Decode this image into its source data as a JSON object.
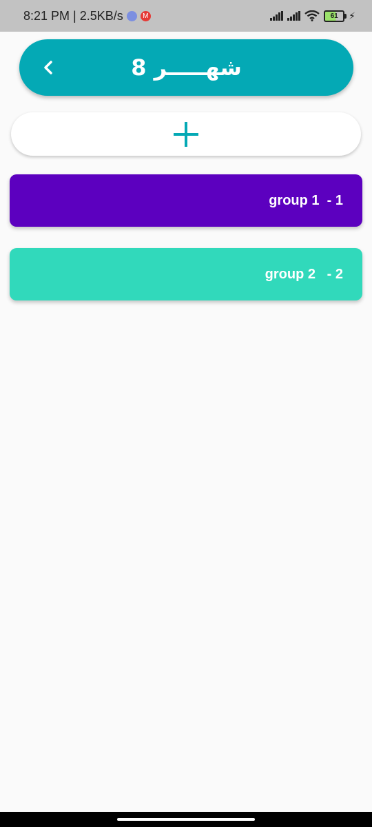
{
  "status_bar": {
    "time_speed": "8:21 PM | 2.5KB/s",
    "battery_level": "61",
    "notification_icons": [
      "discord-icon",
      "mail-icon"
    ],
    "right_icons": [
      "signal-icon",
      "signal-icon",
      "wifi-icon",
      "battery-icon",
      "charging-icon"
    ]
  },
  "header": {
    "title": "شهـــــر 8",
    "back_icon": "chevron-left-icon",
    "color": "#04a9b5"
  },
  "add_button": {
    "icon": "plus-icon",
    "color": "#04a9b5"
  },
  "groups": [
    {
      "label": "group 1  - 1",
      "color": "#5c00bf"
    },
    {
      "label": "group 2   - 2",
      "color": "#31d9bb"
    }
  ]
}
